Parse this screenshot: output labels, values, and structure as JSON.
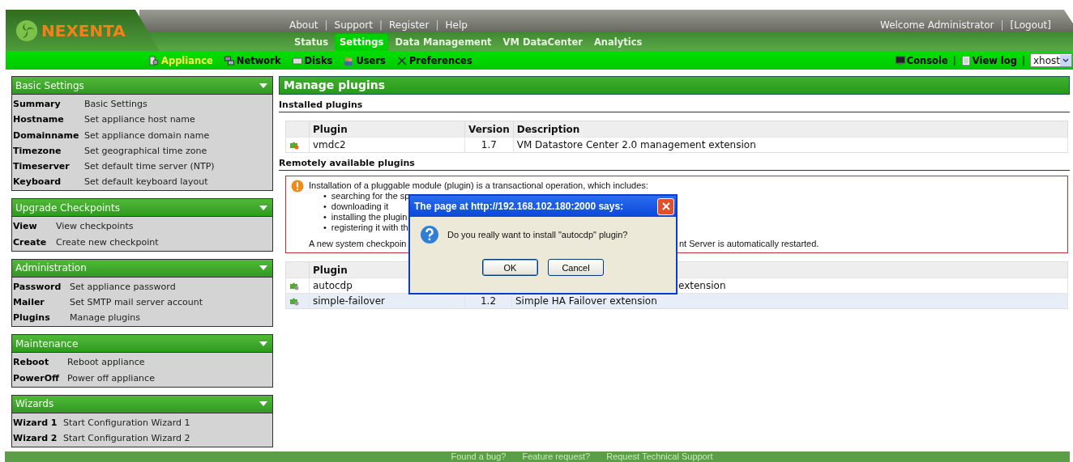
{
  "header": {
    "logo": "NEXENTA",
    "top_links": [
      {
        "kind": "link",
        "label": "About"
      },
      {
        "kind": "separator",
        "label": "|"
      },
      {
        "kind": "link",
        "label": "Support"
      },
      {
        "kind": "separator",
        "label": "|"
      },
      {
        "kind": "link",
        "label": "Register"
      },
      {
        "kind": "separator",
        "label": "|"
      },
      {
        "kind": "link",
        "label": "Help"
      }
    ],
    "user_links": [
      {
        "kind": "link",
        "label": "Welcome Administrator"
      },
      {
        "kind": "separator",
        "label": "|"
      },
      {
        "kind": "link",
        "label": "[Logout]"
      }
    ]
  },
  "main_tabs": [
    {
      "label": "Status",
      "selected": false
    },
    {
      "label": "Settings",
      "selected": true
    },
    {
      "label": "Data Management",
      "selected": false
    },
    {
      "label": "VM DataCenter",
      "selected": false
    },
    {
      "label": "Analytics",
      "selected": false
    }
  ],
  "sub_tabs": [
    {
      "label": "Appliance",
      "selected": true
    },
    {
      "label": "Network",
      "selected": false
    },
    {
      "label": "Disks",
      "selected": false
    },
    {
      "label": "Users",
      "selected": false
    },
    {
      "label": "Preferences",
      "selected": false
    }
  ],
  "tools": [
    {
      "kind": "console",
      "label": "Console"
    },
    {
      "kind": "separator",
      "label": "|"
    },
    {
      "kind": "log",
      "label": "View log"
    },
    {
      "kind": "separator",
      "label": "|"
    }
  ],
  "host_select": {
    "value": "xhost"
  },
  "sidebar": [
    {
      "title": "Basic Settings",
      "items": [
        {
          "name": "Summary",
          "description": "Basic Settings"
        },
        {
          "name": "Hostname",
          "description": "Set appliance host name"
        },
        {
          "name": "Domainname",
          "description": "Set appliance domain name"
        },
        {
          "name": "Timezone",
          "description": "Set geographical time zone"
        },
        {
          "name": "Timeserver",
          "description": "Set default time server (NTP)"
        },
        {
          "name": "Keyboard",
          "description": "Set default keyboard layout"
        }
      ]
    },
    {
      "title": "Upgrade Checkpoints",
      "items": [
        {
          "name": "View",
          "description": "View checkpoints"
        },
        {
          "name": "Create",
          "description": "Create new checkpoint"
        }
      ]
    },
    {
      "title": "Administration",
      "items": [
        {
          "name": "Password",
          "description": "Set appliance password"
        },
        {
          "name": "Mailer",
          "description": "Set SMTP mail server account"
        },
        {
          "name": "Plugins",
          "description": "Manage plugins"
        }
      ]
    },
    {
      "title": "Maintenance",
      "items": [
        {
          "name": "Reboot",
          "description": "Reboot appliance"
        },
        {
          "name": "PowerOff",
          "description": "Power off appliance"
        }
      ]
    },
    {
      "title": "Wizards",
      "items": [
        {
          "name": "Wizard 1",
          "description": "Start Configuration Wizard 1"
        },
        {
          "name": "Wizard 2",
          "description": "Start Configuration Wizard 2"
        }
      ]
    }
  ],
  "page_title": "Manage plugins",
  "installed": {
    "heading": "Installed plugins",
    "columns": [
      "Plugin",
      "Version",
      "Description"
    ],
    "rows": [
      {
        "plugin": "vmdc2",
        "version": "1.7",
        "description": "VM Datastore Center 2.0 management extension",
        "selected": false
      }
    ]
  },
  "remote": {
    "heading": "Remotely available plugins",
    "notice": {
      "intro": "Installation of a pluggable module (plugin) is a transactional operation, which includes:",
      "bullets": [
        {
          "marker": "•",
          "text": "searching for the sp"
        },
        {
          "marker": "•",
          "text": "downloading it"
        },
        {
          "marker": "•",
          "text": "installing the plugin"
        },
        {
          "marker": "•",
          "text": "registering it with th"
        }
      ],
      "closing_start": "A new system checkpoin",
      "closing_end": "nt Server is automatically restarted."
    },
    "columns": [
      "Plugin"
    ],
    "rows": [
      {
        "plugin": "autocdp",
        "description": "extension",
        "selected": false
      },
      {
        "plugin": "simple-failover",
        "version": "1.2",
        "description": "Simple HA Failover extension",
        "selected": true
      }
    ]
  },
  "dialog": {
    "title": "The page at http://192.168.102.180:2000 says:",
    "message": "Do you really want to install \"autocdp\" plugin?",
    "buttons": [
      "OK",
      "Cancel"
    ]
  },
  "footer_links": [
    "Found a bug?",
    "Feature request?",
    "Request Technical Support"
  ]
}
